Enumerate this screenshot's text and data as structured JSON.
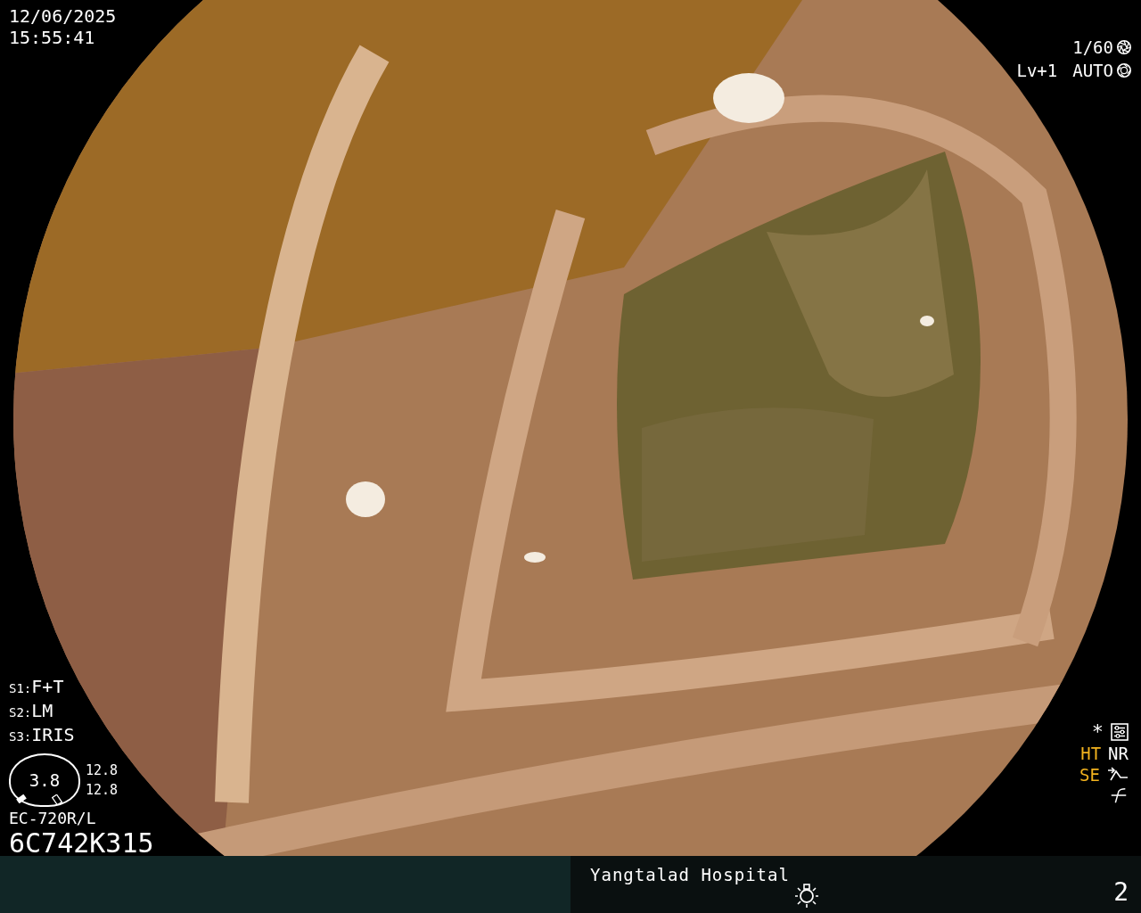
{
  "timestamp": {
    "date": "12/06/2025",
    "time": "15:55:41"
  },
  "exposure": {
    "shutter": "1/60",
    "level": "Lv+1",
    "iris_mode": "AUTO"
  },
  "scope_settings": [
    {
      "label": "S1:",
      "value": "F+T"
    },
    {
      "label": "S2:",
      "value": "LM"
    },
    {
      "label": "S3:",
      "value": "IRIS"
    }
  ],
  "gauge": {
    "value": "3.8",
    "readings": [
      "12.8",
      "12.8"
    ]
  },
  "scope": {
    "model": "EC-720R/L",
    "serial": "6C742K315"
  },
  "marker": "*",
  "indicators": [
    {
      "label": "HT",
      "color": "#f2b21e"
    },
    {
      "label": "NR",
      "color": "#ffffff"
    },
    {
      "label": "SE",
      "color": "#f2b21e"
    }
  ],
  "footer": {
    "hospital": "Yangtalad Hospital",
    "page": "2"
  }
}
